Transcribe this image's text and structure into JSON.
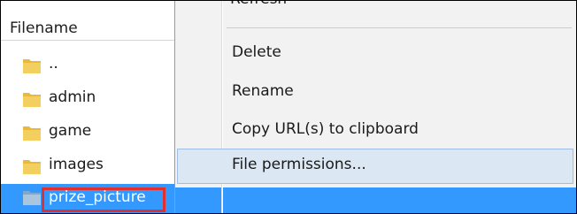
{
  "file_list": {
    "header": "Filename",
    "rows": [
      {
        "name": ".."
      },
      {
        "name": "admin"
      },
      {
        "name": "game"
      },
      {
        "name": "images"
      },
      {
        "name": "prize_picture"
      }
    ],
    "selected_index": 4
  },
  "context_menu": {
    "clipped_top_item": "Refresh",
    "items": [
      {
        "label": "Delete"
      },
      {
        "label": "Rename"
      },
      {
        "label": "Copy URL(s) to clipboard"
      },
      {
        "label": "File permissions..."
      }
    ],
    "hover_index": 3
  },
  "colors": {
    "selection": "#3399ff",
    "menu_bg": "#f2f2f2",
    "menu_hover_bg": "#dce7f4",
    "highlight_border": "#e03030",
    "folder": "#e8b93c"
  }
}
